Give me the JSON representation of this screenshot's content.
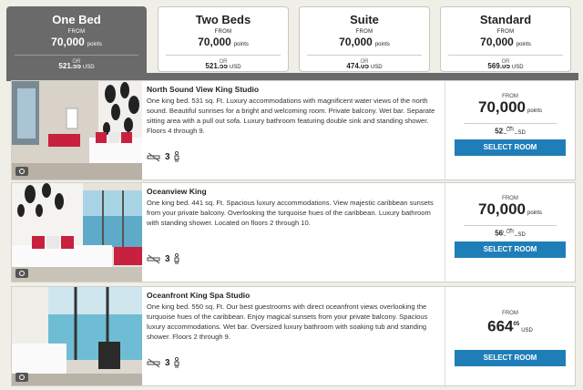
{
  "tabs": [
    {
      "name": "One Bed",
      "from": "FROM",
      "points": "70,000",
      "points_unit": "points",
      "or": "OR",
      "usd": "521.55",
      "usd_unit": "USD"
    },
    {
      "name": "Two Beds",
      "from": "FROM",
      "points": "70,000",
      "points_unit": "points",
      "or": "OR",
      "usd": "521.55",
      "usd_unit": "USD"
    },
    {
      "name": "Suite",
      "from": "FROM",
      "points": "70,000",
      "points_unit": "points",
      "or": "OR",
      "usd": "474.05",
      "usd_unit": "USD"
    },
    {
      "name": "Standard",
      "from": "FROM",
      "points": "70,000",
      "points_unit": "points",
      "or": "OR",
      "usd": "569.05",
      "usd_unit": "USD"
    }
  ],
  "rooms": [
    {
      "name": "North Sound View King Studio",
      "description": "One king bed. 531 sq. Ft. Luxury accommodations with magnificent water views of the north sound. Beautiful sunrises for a bright and welcoming room. Private balcony. Wet bar. Separate sitting area with a pull out sofa. Luxury bathroom featuring double sink and standing shower. Floors 4 through 9.",
      "occupancy": "3",
      "from": "FROM",
      "points": "70,000",
      "points_unit": "points",
      "or": "OR",
      "usd_whole": "521",
      "usd_cents": "55",
      "usd_unit": "USD",
      "button": "SELECT ROOM"
    },
    {
      "name": "Oceanview King",
      "description": "One king bed. 441 sq. Ft. Spacious luxury accommodations. View majestic caribbean sunsets from your private balcony. Overlooking the turquoise hues of the caribbean. Luxury bathroom with standing shower. Located on floors 2 through 10.",
      "occupancy": "3",
      "from": "FROM",
      "points": "70,000",
      "points_unit": "points",
      "or": "OR",
      "usd_whole": "569",
      "usd_cents": "05",
      "usd_unit": "USD",
      "button": "SELECT ROOM"
    },
    {
      "name": "Oceanfront King Spa Studio",
      "description": "One king bed. 550 sq. Ft. Our best guestrooms with direct oceanfront views overlooking the turquoise hues of the caribbean. Enjoy magical sunsets from your private balcony. Spacious luxury accommodations. Wet bar. Oversized luxury bathroom with soaking tub and standing shower. Floors 2 through 9.",
      "occupancy": "3",
      "from": "FROM",
      "price_whole": "664",
      "price_cents": "05",
      "price_unit": "USD",
      "button": "SELECT ROOM"
    }
  ]
}
